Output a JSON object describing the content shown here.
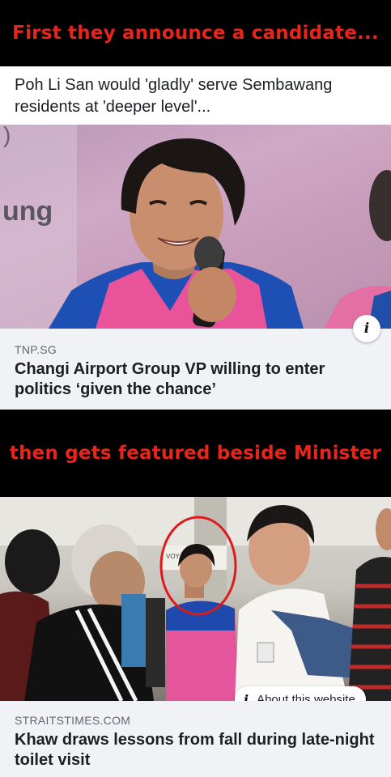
{
  "banners": {
    "top": "First they announce a candidate...",
    "middle": "then gets featured beside Minister"
  },
  "post1": {
    "snippet": "Poh Li San would 'gladly' serve Sembawang residents at 'deeper level'...",
    "photo_sign_text": "ung",
    "photo_sign_partial": ")",
    "info_icon": "info-icon",
    "domain": "TNP.SG",
    "headline": "Changi Airport Group VP willing to enter politics ‘given the chance’"
  },
  "post2": {
    "photo_sign_text": "VOY",
    "about_label": "About this website",
    "info_icon": "info-icon",
    "domain": "STRAITSTIMES.COM",
    "headline": "Khaw draws lessons from fall during late-night toilet visit"
  },
  "colors": {
    "banner_text": "#e8241b",
    "banner_bg": "#000000",
    "meta_bg": "#f0f2f5",
    "highlight_circle": "#e0191b"
  }
}
